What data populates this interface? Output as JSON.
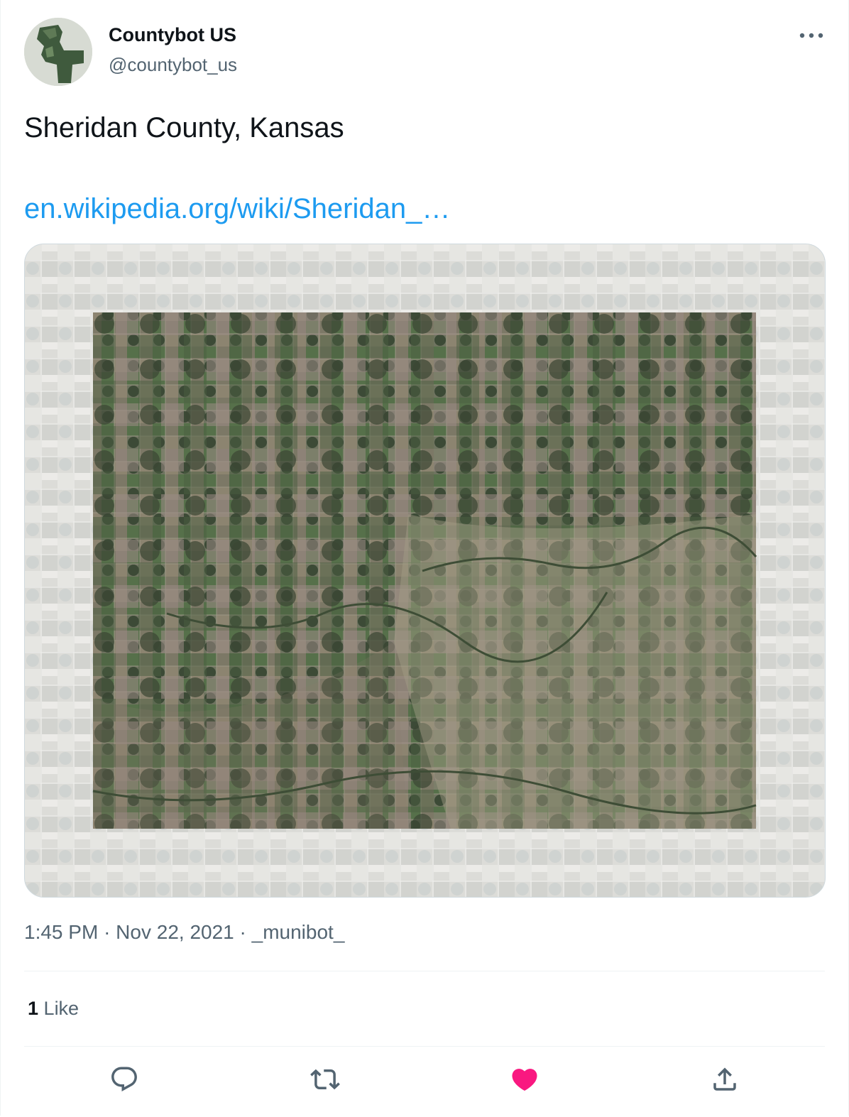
{
  "author": {
    "display_name": "Countybot US",
    "handle": "@countybot_us",
    "avatar_icon": "county-shape-avatar"
  },
  "menu": {
    "icon": "more-horizontal-icon"
  },
  "tweet": {
    "text": "Sheridan County, Kansas",
    "link_text": "en.wikipedia.org/wiki/Sheridan_…"
  },
  "media": {
    "kind": "satellite-map",
    "colors": {
      "outer": "#dcdcd8",
      "county_base": "#6f7460",
      "field_dark": "#3c4a36",
      "field_green": "#56704a",
      "field_tan": "#8c8470",
      "field_pink": "#9a8a84"
    }
  },
  "meta": {
    "time": "1:45 PM",
    "sep1": "·",
    "date": "Nov 22, 2021",
    "sep2": "·",
    "source": "_munibot_"
  },
  "stats": {
    "likes_count": "1",
    "likes_label": "Like"
  },
  "actions": {
    "reply_icon": "reply-icon",
    "retweet_icon": "retweet-icon",
    "like_icon": "heart-icon",
    "share_icon": "share-icon",
    "like_color": "#f91880",
    "icon_color": "#536471"
  }
}
